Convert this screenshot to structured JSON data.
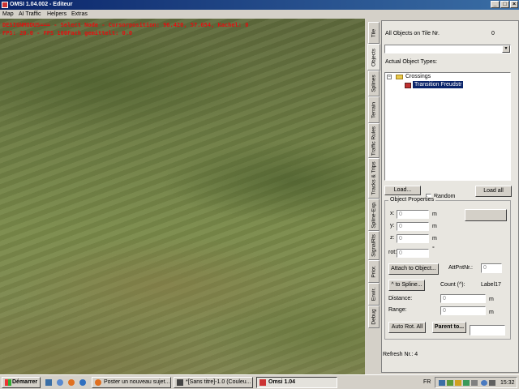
{
  "window": {
    "title": "OMSI 1.04.002 - Editeur"
  },
  "menu": [
    "Map",
    "AI Traffic",
    "Helpers",
    "Extras"
  ],
  "viewport": {
    "debug_line1": "DESIGNMODUS=== - Select Node - Cursorposition: 96.420, 57.654, Kachel: 0",
    "debug_line2": "FPS: 20.0 - FPS 100Fach gemittelt: 0.0"
  },
  "side_tabs": [
    "Tile",
    "Objects",
    "Splines",
    "Terrain",
    "Traffic Rules",
    "Tracks & Trips",
    "Spline-Exp.",
    "SignalRts",
    "Prior.",
    "Envir.",
    "Debug"
  ],
  "objects_panel": {
    "all_objects_label": "All Objects on Tile Nr.",
    "all_objects_count": "0",
    "actual_types_label": "Actual Object Types:",
    "tree": {
      "folder": "Crossings",
      "child": "Transition Freudstr"
    },
    "load_button": "Load...",
    "random_label": "Random",
    "load_all_button": "Load all",
    "properties_title": "Object Properties",
    "x_label": "x:",
    "x_value": "0",
    "y_label": "y:",
    "y_value": "0",
    "z_label": "z:",
    "z_value": "0",
    "rot_label": "rot:",
    "rot_value": "0",
    "unit_m": "m",
    "unit_deg": "°",
    "attach_button": "Attach to Object...",
    "attpnt_label": "AttPntNr.:",
    "attpnt_value": "0",
    "spline_button": "^ to Spline...",
    "count_label": "Count (^):",
    "label_text": "Label17",
    "distance_label": "Distance:",
    "distance_value": "0",
    "range_label": "Range:",
    "range_value": "0",
    "autorot_button": "Auto Rot. All",
    "parent_button": "Parent to...",
    "refresh_label": "Refresh Nr.: 4"
  },
  "taskbar": {
    "start": "Démarrer",
    "tasks": [
      "Poster un nouveau sujet...",
      "*[Sans titre]-1.0 (Couleu...",
      "Omsi 1.04"
    ],
    "lang": "FR",
    "clock": "15:32"
  }
}
